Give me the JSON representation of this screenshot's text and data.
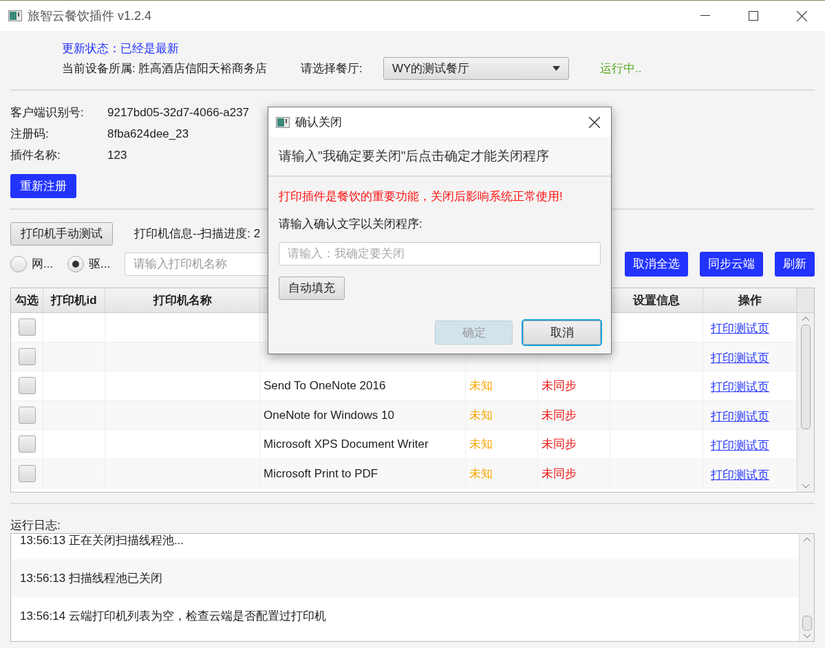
{
  "window": {
    "title": "旅智云餐饮插件 v1.2.4"
  },
  "header": {
    "update_status": "更新状态：已经是最新",
    "device_owner": "当前设备所属: 胜高酒店信阳天裕商务店",
    "restaurant_label": "请选择餐厅:",
    "restaurant_select": "WY的测试餐厅",
    "run_status": "运行中.."
  },
  "info": [
    {
      "label": "客户端识别号:",
      "value": "9217bd05-32d7-4066-a237"
    },
    {
      "label": "注册码:",
      "value": "8fba624dee_23"
    },
    {
      "label": "插件名称:",
      "value": "123"
    }
  ],
  "reregister_button": "重新注册",
  "printer_toolbar": {
    "manual_test_button": "打印机手动测试",
    "scan_info": "打印机信息--扫描进度: 2",
    "radios": [
      {
        "label": "网...",
        "selected": false
      },
      {
        "label": "驱...",
        "selected": true
      }
    ],
    "search": {
      "placeholder": "请输入打印机名称"
    },
    "buttons": [
      "取消全选",
      "同步云端",
      "刷新"
    ]
  },
  "table": {
    "columns": [
      {
        "label": "勾选"
      },
      {
        "label": "打印机id"
      },
      {
        "label": "打印机名称"
      },
      {},
      {},
      {},
      {
        "label": "设置信息"
      },
      {
        "label": "操作"
      }
    ],
    "rows": [
      {
        "checked": false,
        "action": "打印测试页"
      },
      {
        "checked": false,
        "action": "打印测试页"
      },
      {
        "checked": false,
        "column_4": "Send To OneNote 2016",
        "column_5": "未知",
        "column_6": "未同步",
        "action": "打印测试页"
      },
      {
        "checked": false,
        "column_4": "OneNote for Windows 10",
        "column_5": "未知",
        "column_6": "未同步",
        "action": "打印测试页"
      },
      {
        "checked": false,
        "column_4": "Microsoft XPS Document Writer",
        "column_5": "未知",
        "column_6": "未同步",
        "action": "打印测试页"
      },
      {
        "checked": false,
        "column_4": "Microsoft Print to PDF",
        "column_5": "未知",
        "column_6": "未同步",
        "action": "打印测试页"
      }
    ]
  },
  "log": {
    "label": "运行日志:",
    "lines": [
      "13:56:13 正在关闭扫描线程池...",
      "13:56:13 扫描线程池已关闭",
      "13:56:14 云端打印机列表为空，检查云端是否配置过打印机"
    ]
  },
  "dialog": {
    "title": "确认关闭",
    "heading": "请输入\"我确定要关闭\"后点击确定才能关闭程序",
    "warning": "打印插件是餐饮的重要功能，关闭后影响系统正常使用!",
    "prompt": "请输入确认文字以关闭程序:",
    "input": {
      "placeholder": "请输入：我确定要关闭"
    },
    "autofill_button": "自动填充",
    "ok_button": {
      "label": "确定",
      "disabled": true
    },
    "cancel_button": {
      "label": "取消",
      "disabled": false
    }
  }
}
